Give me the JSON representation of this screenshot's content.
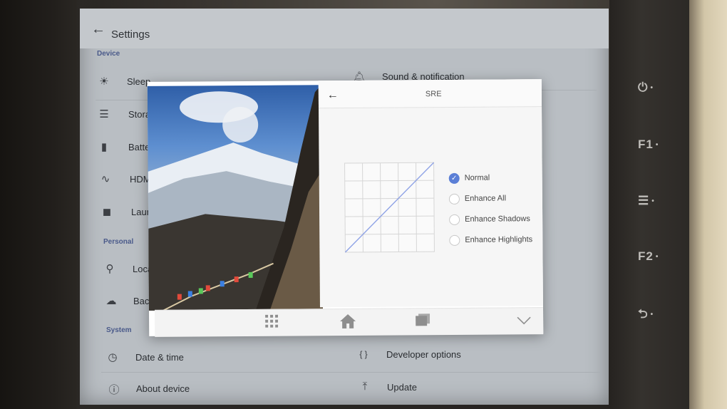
{
  "header": {
    "back_icon": "arrow-left-icon",
    "title": "Settings"
  },
  "sections": {
    "device": "Device",
    "personal": "Personal",
    "system": "System"
  },
  "left_items": [
    {
      "label": "Sleep",
      "icon": "brightness-icon"
    },
    {
      "label": "Stora",
      "icon": "storage-icon"
    },
    {
      "label": "Batte",
      "icon": "battery-icon"
    },
    {
      "label": "HDM",
      "icon": "hdmi-icon"
    },
    {
      "label": "Laun",
      "icon": "launcher-icon"
    },
    {
      "label": "Loca",
      "icon": "location-icon"
    },
    {
      "label": "Back",
      "icon": "cloud-upload-icon"
    },
    {
      "label": "Date & time",
      "icon": "clock-icon"
    },
    {
      "label": "About device",
      "icon": "info-icon"
    }
  ],
  "right_items": [
    {
      "label": "Sound & notification",
      "icon": "bell-icon"
    },
    {
      "label": "Developer options",
      "icon": "braces-icon"
    },
    {
      "label": "Update",
      "icon": "upload-icon"
    }
  ],
  "dialog": {
    "back_icon": "arrow-left-icon",
    "title": "SRE",
    "options": [
      {
        "label": "Normal",
        "checked": true
      },
      {
        "label": "Enhance All",
        "checked": false
      },
      {
        "label": "Enhance Shadows",
        "checked": false
      },
      {
        "label": "Enhance Highlights",
        "checked": false
      }
    ]
  },
  "navbar": {
    "apps_icon": "apps-grid-icon",
    "home_icon": "home-icon",
    "recents_icon": "recents-icon",
    "collapse_icon": "chevron-down-icon"
  },
  "hardware_buttons": [
    "⏻",
    "F1",
    "☰",
    "F2",
    "⮌"
  ],
  "colors": {
    "accent": "#5b7fd6",
    "section_label": "#4a5a8a",
    "curve": "#8fa3e6"
  }
}
